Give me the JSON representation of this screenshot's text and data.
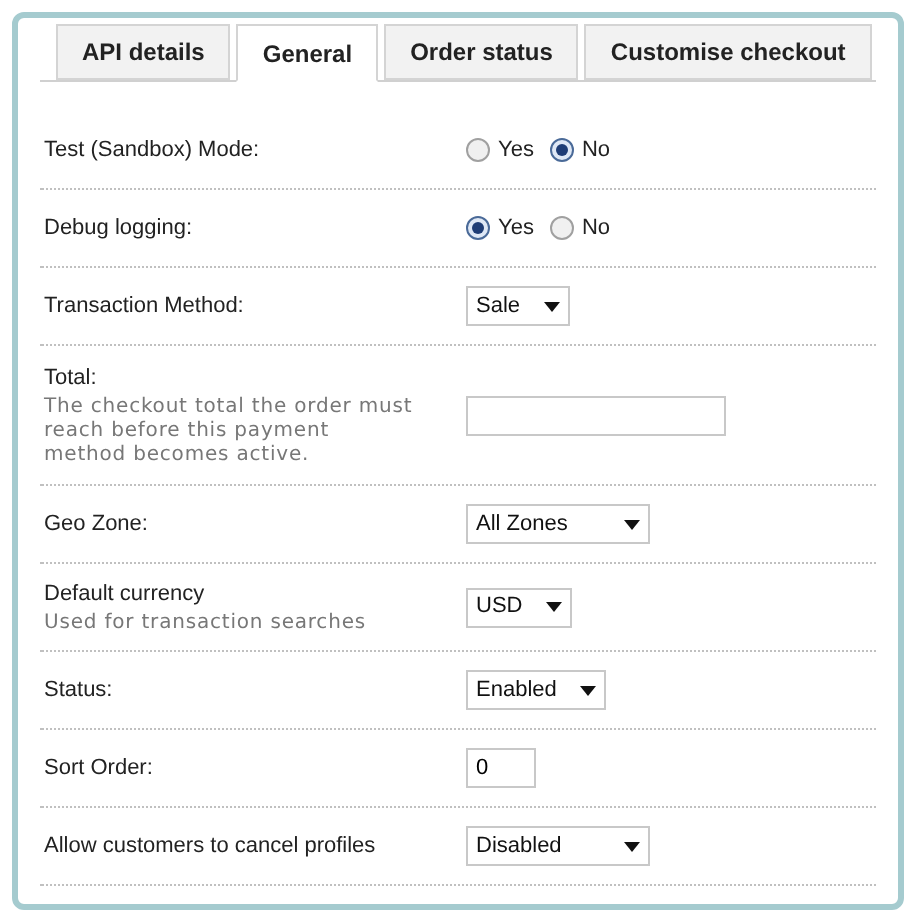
{
  "tabs": [
    {
      "label": "API details",
      "selected": false
    },
    {
      "label": "General",
      "selected": true
    },
    {
      "label": "Order status",
      "selected": false
    },
    {
      "label": "Customise checkout",
      "selected": false
    }
  ],
  "fields": [
    {
      "kind": "radio",
      "label": "Test (Sandbox) Mode:",
      "options": [
        {
          "label": "Yes",
          "selected": false
        },
        {
          "label": "No",
          "selected": true
        }
      ]
    },
    {
      "kind": "radio",
      "label": "Debug logging:",
      "options": [
        {
          "label": "Yes",
          "selected": true
        },
        {
          "label": "No",
          "selected": false
        }
      ]
    },
    {
      "kind": "select",
      "label": "Transaction Method:",
      "value": "Sale"
    },
    {
      "kind": "text",
      "label": "Total:",
      "help": "The checkout total the order must reach before this payment method becomes active."
    },
    {
      "kind": "select",
      "label": "Geo Zone:",
      "value": "All Zones"
    },
    {
      "kind": "select",
      "label": "Default currency",
      "help": "Used for transaction searches",
      "value": "USD"
    },
    {
      "kind": "select",
      "label": "Status:",
      "value": "Enabled"
    },
    {
      "kind": "text",
      "label": "Sort Order:",
      "value": "0"
    },
    {
      "kind": "select",
      "label": "Allow customers to cancel profiles",
      "value": "Disabled"
    }
  ]
}
